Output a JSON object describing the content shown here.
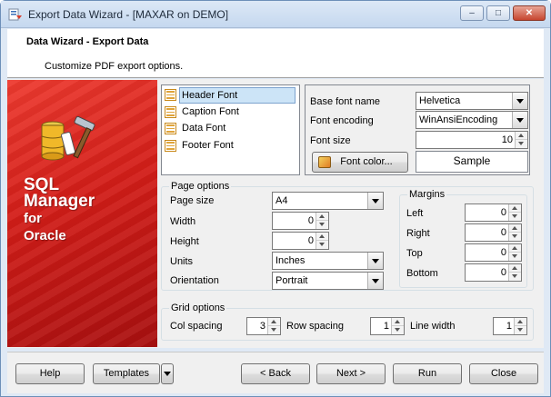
{
  "window": {
    "title": "Export Data Wizard - [MAXAR on DEMO]",
    "controls": {
      "minimize": "–",
      "maximize": "□",
      "close": "✕"
    }
  },
  "header": {
    "title": "Data Wizard - Export Data",
    "subtitle": "Customize PDF export options."
  },
  "banner": {
    "line1": "SQL",
    "line2": "Manager",
    "line3": "for",
    "line4": "Oracle"
  },
  "font_list": {
    "items": [
      {
        "label": "Header Font",
        "selected": true
      },
      {
        "label": "Caption Font",
        "selected": false
      },
      {
        "label": "Data Font",
        "selected": false
      },
      {
        "label": "Footer Font",
        "selected": false
      }
    ]
  },
  "font_settings": {
    "base_font_label": "Base font name",
    "base_font_value": "Helvetica",
    "encoding_label": "Font encoding",
    "encoding_value": "WinAnsiEncoding",
    "size_label": "Font size",
    "size_value": "10",
    "color_button": "Font color...",
    "sample_text": "Sample"
  },
  "page_options": {
    "title": "Page options",
    "page_size_label": "Page size",
    "page_size_value": "A4",
    "width_label": "Width",
    "width_value": "0",
    "height_label": "Height",
    "height_value": "0",
    "units_label": "Units",
    "units_value": "Inches",
    "orientation_label": "Orientation",
    "orientation_value": "Portrait"
  },
  "margins": {
    "title": "Margins",
    "left_label": "Left",
    "left_value": "0",
    "right_label": "Right",
    "right_value": "0",
    "top_label": "Top",
    "top_value": "0",
    "bottom_label": "Bottom",
    "bottom_value": "0"
  },
  "grid_options": {
    "title": "Grid options",
    "col_spacing_label": "Col spacing",
    "col_spacing_value": "3",
    "row_spacing_label": "Row spacing",
    "row_spacing_value": "1",
    "line_width_label": "Line width",
    "line_width_value": "1"
  },
  "footer": {
    "help": "Help",
    "templates": "Templates",
    "back": "< Back",
    "next": "Next >",
    "run": "Run",
    "close": "Close"
  },
  "colors": {
    "banner_red": "#d21d18",
    "selection": "#cce4f7",
    "window_frame": "#dfe9f5"
  }
}
